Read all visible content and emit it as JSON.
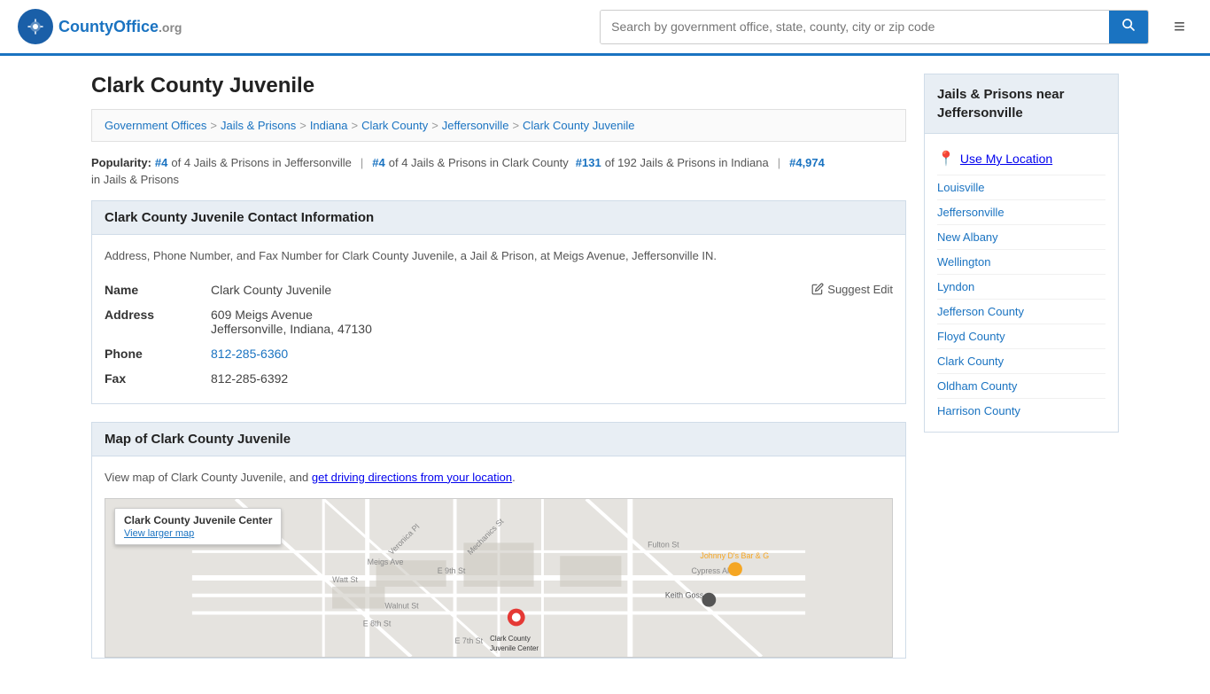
{
  "header": {
    "logo_text": "CountyOffice",
    "logo_org": ".org",
    "search_placeholder": "Search by government office, state, county, city or zip code",
    "search_icon": "🔍",
    "menu_icon": "≡"
  },
  "page": {
    "title": "Clark County Juvenile",
    "breadcrumb": [
      {
        "label": "Government Offices",
        "href": "#"
      },
      {
        "label": "Jails & Prisons",
        "href": "#"
      },
      {
        "label": "Indiana",
        "href": "#"
      },
      {
        "label": "Clark County",
        "href": "#"
      },
      {
        "label": "Jeffersonville",
        "href": "#"
      },
      {
        "label": "Clark County Juvenile",
        "href": "#"
      }
    ],
    "popularity": {
      "label": "Popularity:",
      "items": [
        {
          "rank": "#4",
          "text": "of 4 Jails & Prisons in Jeffersonville"
        },
        {
          "rank": "#4",
          "text": "of 4 Jails & Prisons in Clark County"
        },
        {
          "rank": "#131",
          "text": "of 192 Jails & Prisons in Indiana"
        },
        {
          "rank": "#4,974",
          "text": "in Jails & Prisons"
        }
      ]
    }
  },
  "contact_section": {
    "header": "Clark County Juvenile Contact Information",
    "description": "Address, Phone Number, and Fax Number for Clark County Juvenile, a Jail & Prison, at Meigs Avenue, Jeffersonville IN.",
    "suggest_edit_label": "Suggest Edit",
    "fields": {
      "name_label": "Name",
      "name_value": "Clark County Juvenile",
      "address_label": "Address",
      "address_line1": "609 Meigs Avenue",
      "address_line2": "Jeffersonville, Indiana, 47130",
      "phone_label": "Phone",
      "phone_value": "812-285-6360",
      "fax_label": "Fax",
      "fax_value": "812-285-6392"
    }
  },
  "map_section": {
    "header": "Map of Clark County Juvenile",
    "description": "View map of Clark County Juvenile, and",
    "directions_link": "get driving directions from your location",
    "callout_title": "Clark County Juvenile Center",
    "callout_link": "View larger map",
    "label": "Clark County Juvenile Center"
  },
  "sidebar": {
    "title": "Jails & Prisons near Jeffersonville",
    "use_location": "Use My Location",
    "items": [
      {
        "label": "Louisville",
        "href": "#"
      },
      {
        "label": "Jeffersonville",
        "href": "#"
      },
      {
        "label": "New Albany",
        "href": "#"
      },
      {
        "label": "Wellington",
        "href": "#"
      },
      {
        "label": "Lyndon",
        "href": "#"
      },
      {
        "label": "Jefferson County",
        "href": "#"
      },
      {
        "label": "Floyd County",
        "href": "#"
      },
      {
        "label": "Clark County",
        "href": "#"
      },
      {
        "label": "Oldham County",
        "href": "#"
      },
      {
        "label": "Harrison County",
        "href": "#"
      }
    ]
  }
}
